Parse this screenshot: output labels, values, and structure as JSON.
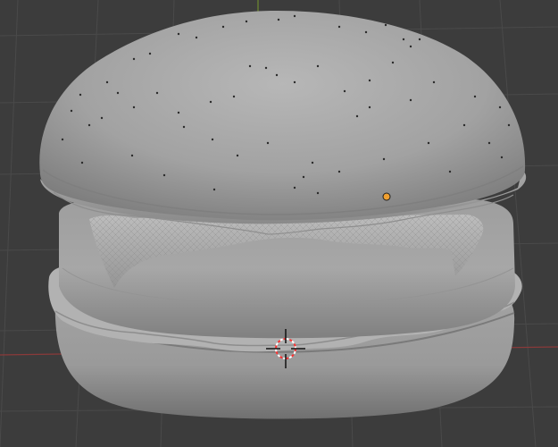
{
  "viewport": {
    "mode": "3d-viewport",
    "shading": "solid",
    "background_color": "#3c3c3c",
    "grid_line_color": "#4a4a4a",
    "axis_x_color": "#8a3a3a",
    "axis_y_color": "#6f8a2e"
  },
  "scene": {
    "object": "hamburger-mesh",
    "mesh_color": "#a8a8a8",
    "parts": [
      "top-bun",
      "sesame-seeds",
      "lettuce",
      "patty",
      "cheese-edge",
      "bottom-bun"
    ],
    "origin_dot_color": "#f0a030",
    "cursor_3d_colors": [
      "#ff3030",
      "#ffffff"
    ]
  }
}
